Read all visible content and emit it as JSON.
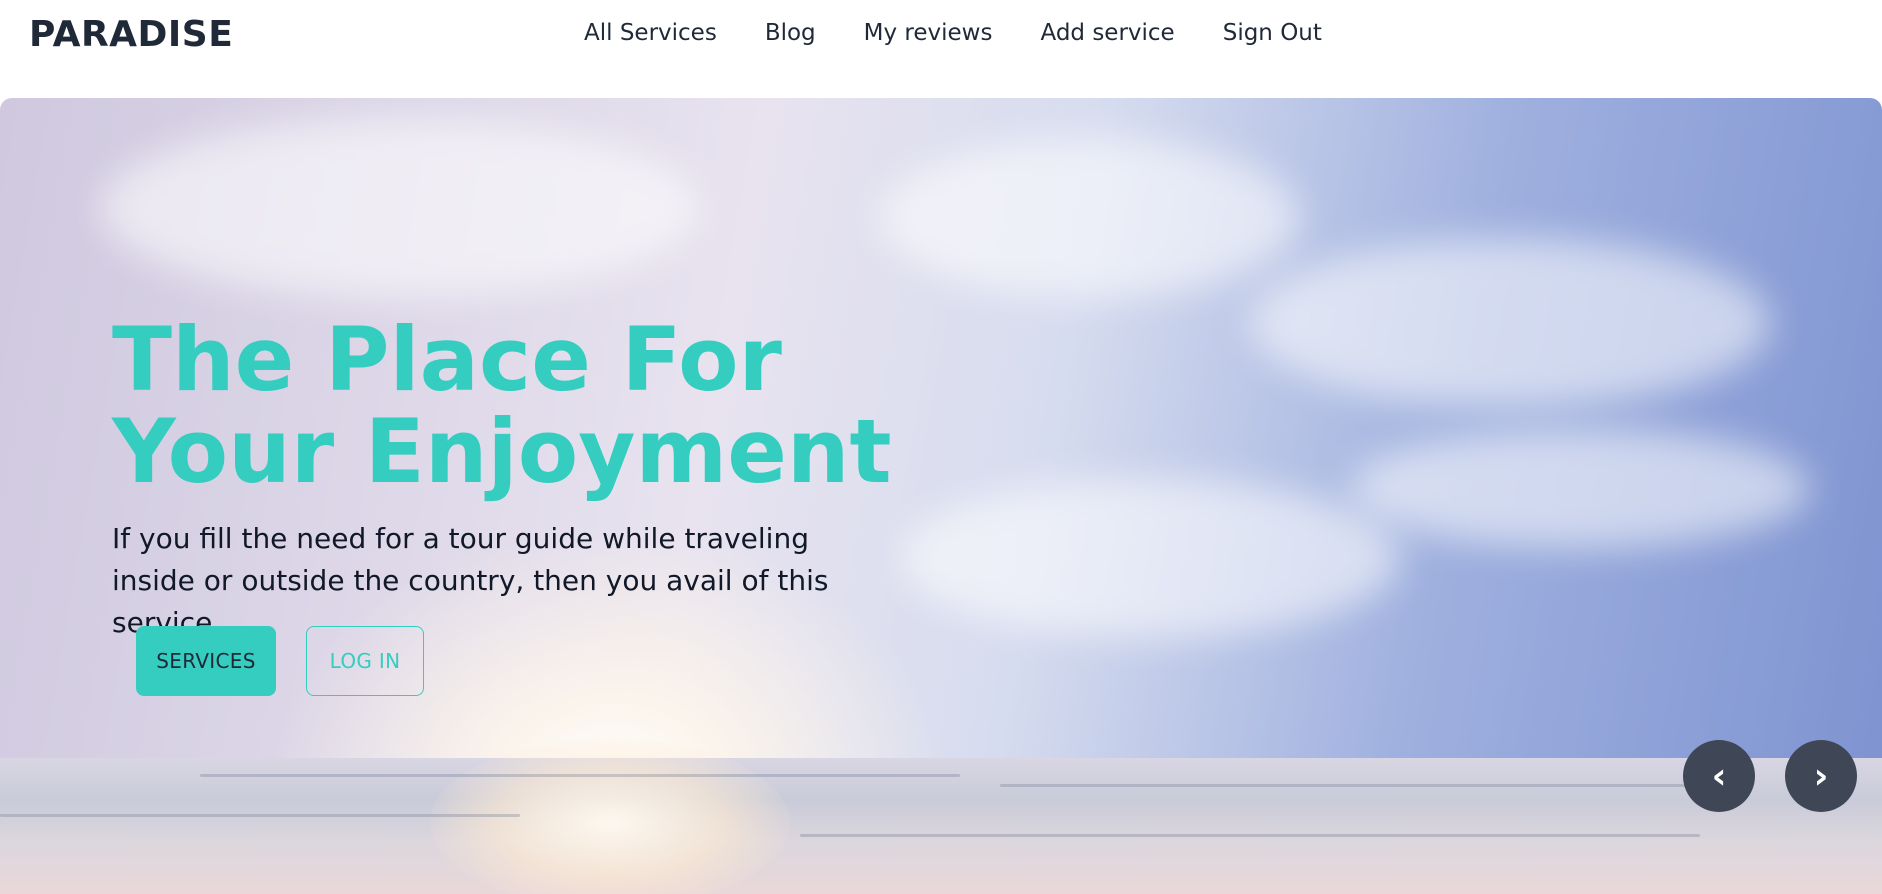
{
  "header": {
    "brand": "PARADISE",
    "nav": [
      {
        "label": "All Services"
      },
      {
        "label": "Blog"
      },
      {
        "label": "My reviews"
      },
      {
        "label": "Add service"
      },
      {
        "label": "Sign Out"
      }
    ]
  },
  "hero": {
    "title": "The Place For Your Enjoyment",
    "description": "If you fill the need for a tour guide while traveling inside or outside the country, then you avail of this service.",
    "primary_button": "SERVICES",
    "secondary_button": "LOG IN",
    "prev_icon": "‹",
    "next_icon": "›",
    "background": "beach-sunset-image"
  },
  "colors": {
    "accent": "#35cdbf",
    "text_dark": "#1f2937",
    "carousel_button": "#3f4756"
  }
}
